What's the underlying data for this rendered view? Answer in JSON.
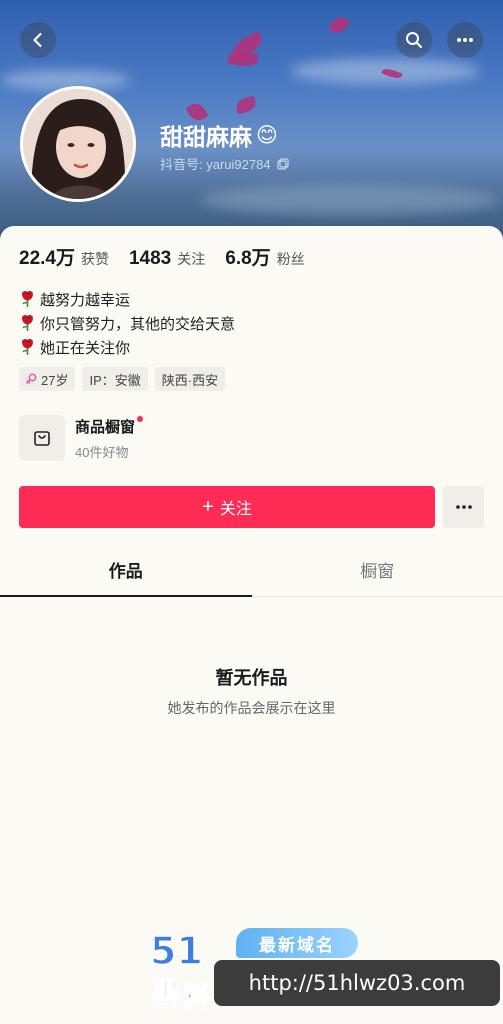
{
  "header": {
    "display_name": "甜甜麻麻",
    "name_emoji": "😊",
    "douyin_id_label": "抖音号:",
    "douyin_id": "yarui92784",
    "icons": [
      "back-icon",
      "search-icon",
      "more-icon",
      "copy-icon"
    ]
  },
  "stats": [
    {
      "value": "22.4万",
      "label": "获赞"
    },
    {
      "value": "1483",
      "label": "关注"
    },
    {
      "value": "6.8万",
      "label": "粉丝"
    }
  ],
  "bio": [
    "越努力越幸运",
    "你只管努力，其他的交给天意",
    "她正在关注你"
  ],
  "tags": [
    {
      "text": "27岁",
      "icon": "female-icon"
    },
    {
      "text": "IP：安徽"
    },
    {
      "text": "陕西·西安"
    }
  ],
  "shop": {
    "title": "商品橱窗",
    "subtitle": "40件好物",
    "icon": "shopping-bag-icon"
  },
  "actions": {
    "follow_label": "关注",
    "follow_prefix": "+",
    "more_label": "···"
  },
  "tabs": [
    {
      "label": "作品",
      "active": true
    },
    {
      "label": "橱窗",
      "active": false
    }
  ],
  "empty_state": {
    "title": "暂无作品",
    "subtitle": "她发布的作品会展示在这里"
  },
  "watermark": {
    "logo_text": "51黑料",
    "badge_text": "最新域名",
    "url": "http://51hlwz03.com"
  },
  "colors": {
    "accent": "#fe2c55",
    "header_top": "#2f5fb0",
    "background": "#fbfaf5"
  }
}
